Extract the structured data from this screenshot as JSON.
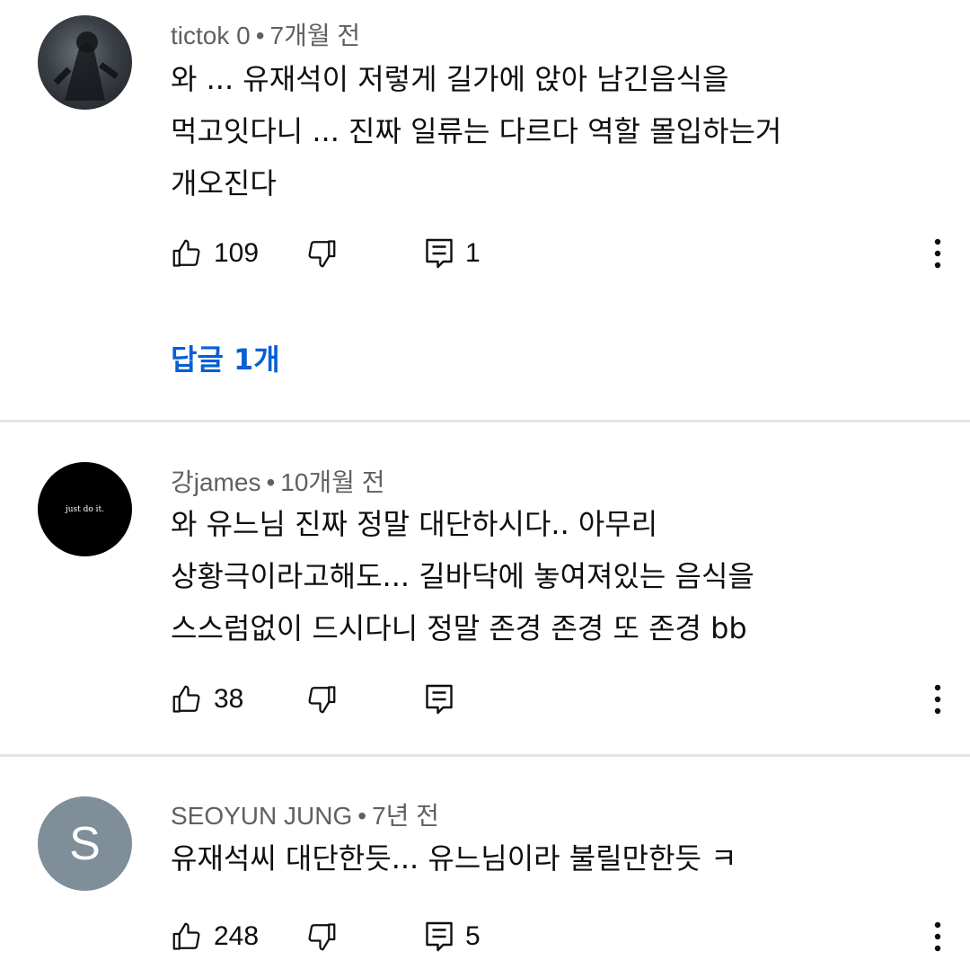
{
  "comments": [
    {
      "author": "tictok 0",
      "time": "7개월 전",
      "lines": [
        "와 ... 유재석이 저렇게 길가에 앉아 남긴음식을",
        "먹고잇다니 ... 진짜 일류는 다르다 역할 몰입하는거",
        "개오진다"
      ],
      "likes": "109",
      "reply_count": "1",
      "replies_link": "답글 1개",
      "avatar_icon": "spiderman-avatar-icon"
    },
    {
      "author": "강james",
      "time": "10개월 전",
      "lines": [
        "와 유느님 진짜 정말 대단하시다.. 아무리",
        "상황극이라고해도... 길바닥에 놓여져있는 음식을",
        "스스럼없이 드시다니 정말 존경 존경 또 존경 bb"
      ],
      "likes": "38",
      "avatar_text": "just do it."
    },
    {
      "author": "SEOYUN JUNG",
      "time": "7년 전",
      "lines": [
        "유재석씨 대단한듯... 유느님이라 불릴만한듯 ㅋ"
      ],
      "likes": "248",
      "reply_count": "5",
      "avatar_letter": "S"
    }
  ],
  "separator": "•",
  "colors": {
    "meta": "#606060",
    "link": "#065fd4",
    "divider": "#e5e5e5",
    "avatar_letter_bg": "#7f8f9a"
  }
}
